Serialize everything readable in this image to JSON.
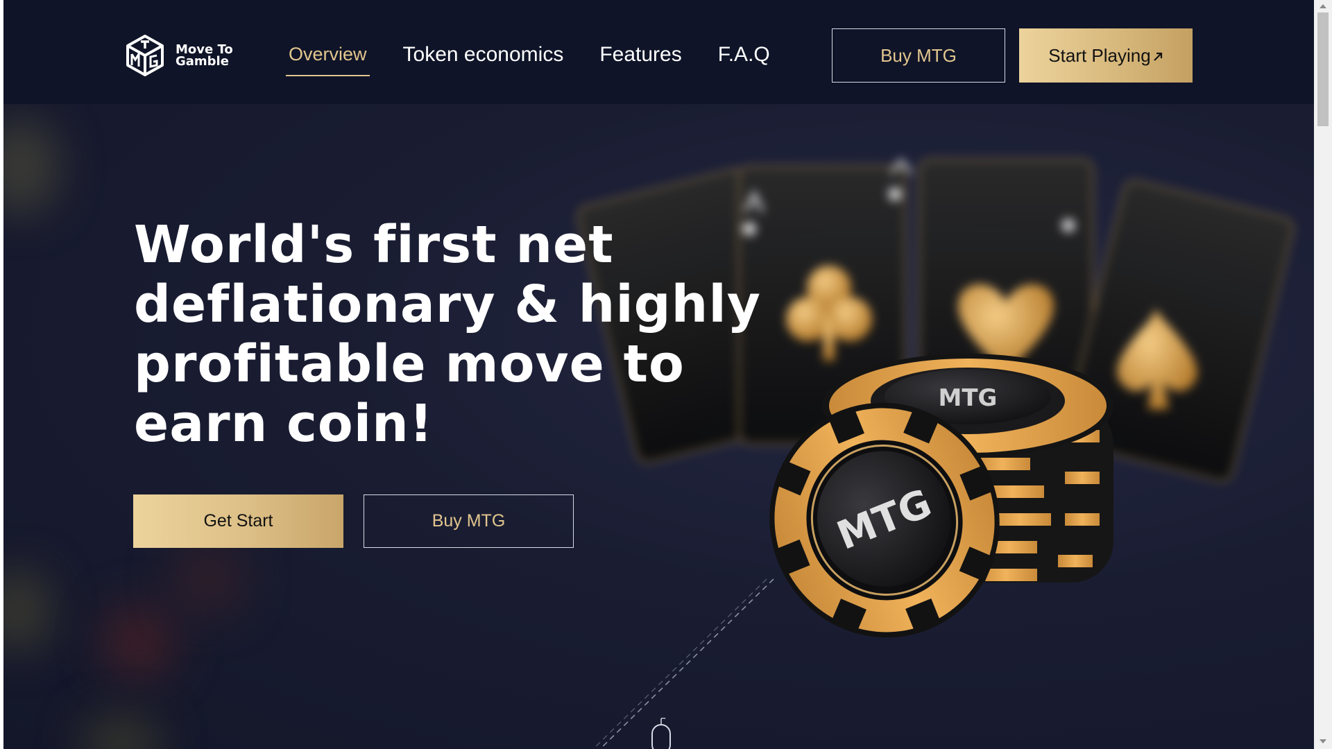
{
  "brand": {
    "name_line1": "Move To",
    "name_line2": "Gamble",
    "logo_icon": "mtg-cube-logo"
  },
  "nav": {
    "items": [
      {
        "label": "Overview",
        "active": true
      },
      {
        "label": "Token economics",
        "active": false
      },
      {
        "label": "Features",
        "active": false
      },
      {
        "label": "F.A.Q",
        "active": false
      }
    ]
  },
  "header_actions": {
    "buy_label": "Buy MTG",
    "start_label": "Start Playing",
    "start_icon": "arrow-up-right-icon"
  },
  "hero": {
    "title": "World's first net deflationary & highly profitable move to earn coin!",
    "primary_label": "Get Start",
    "secondary_label": "Buy MTG",
    "chip_logo_top": "MTG",
    "chip_logo_front": "MTG"
  },
  "colors": {
    "accent_gold": "#e2c68e",
    "header_bg": "#0f1428",
    "page_bg": "#1a1d32"
  }
}
